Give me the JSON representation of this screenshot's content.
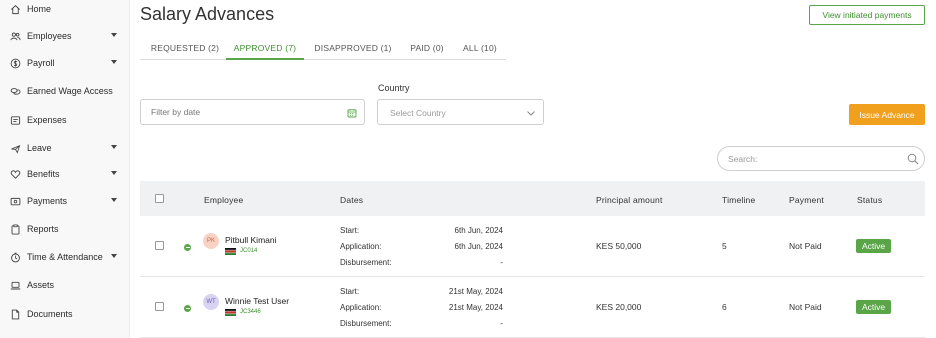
{
  "sidebar": {
    "items": [
      {
        "label": "Home",
        "icon": "home-icon",
        "has_caret": false
      },
      {
        "label": "Employees",
        "icon": "users-icon",
        "has_caret": true
      },
      {
        "label": "Payroll",
        "icon": "dollar-icon",
        "has_caret": true
      },
      {
        "label": "Earned Wage Access",
        "icon": "coins-icon",
        "has_caret": false
      },
      {
        "label": "Expenses",
        "icon": "receipt-icon",
        "has_caret": false
      },
      {
        "label": "Leave",
        "icon": "plane-icon",
        "has_caret": true
      },
      {
        "label": "Benefits",
        "icon": "heart-icon",
        "has_caret": true
      },
      {
        "label": "Payments",
        "icon": "wallet-icon",
        "has_caret": true
      },
      {
        "label": "Reports",
        "icon": "clipboard-icon",
        "has_caret": false
      },
      {
        "label": "Time & Attendance",
        "icon": "clock-icon",
        "has_caret": true
      },
      {
        "label": "Assets",
        "icon": "laptop-icon",
        "has_caret": false
      },
      {
        "label": "Documents",
        "icon": "document-icon",
        "has_caret": false
      }
    ]
  },
  "header": {
    "title": "Salary Advances",
    "view_initiated_label": "View initiated payments"
  },
  "tabs": [
    {
      "label": "REQUESTED (2)",
      "active": false
    },
    {
      "label": "APPROVED (7)",
      "active": true
    },
    {
      "label": "DISAPPROVED (1)",
      "active": false
    },
    {
      "label": "PAID (0)",
      "active": false
    },
    {
      "label": "ALL (10)",
      "active": false
    }
  ],
  "filters": {
    "date_placeholder": "Filter by date",
    "country_label": "Country",
    "country_placeholder": "Select Country",
    "issue_advance_label": "Issue Advance",
    "search_placeholder": "Search:"
  },
  "table": {
    "headers": {
      "employee": "Employee",
      "dates": "Dates",
      "principal": "Principal amount",
      "timeline": "Timeline",
      "payment": "Payment",
      "status": "Status"
    },
    "date_labels": {
      "start": "Start:",
      "application": "Application:",
      "disbursement": "Disbursement:"
    },
    "rows": [
      {
        "initials": "PK",
        "avatar_bg": "#f8d3c4",
        "avatar_fg": "#c0664a",
        "name": "Pitbull Kimani",
        "code": "JC014",
        "start": "6th Jun, 2024",
        "application": "6th Jun, 2024",
        "disbursement": "-",
        "principal": "KES 50,000",
        "timeline": "5",
        "payment": "Not Paid",
        "status": "Active"
      },
      {
        "initials": "WT",
        "avatar_bg": "#d9d3f2",
        "avatar_fg": "#6a5bb8",
        "name": "Winnie Test User",
        "code": "JC3446",
        "start": "21st May, 2024",
        "application": "21st May, 2024",
        "disbursement": "-",
        "principal": "KES 20,000",
        "timeline": "6",
        "payment": "Not Paid",
        "status": "Active"
      }
    ]
  },
  "colors": {
    "accent_green": "#5aa548",
    "accent_orange": "#f0a01c"
  }
}
